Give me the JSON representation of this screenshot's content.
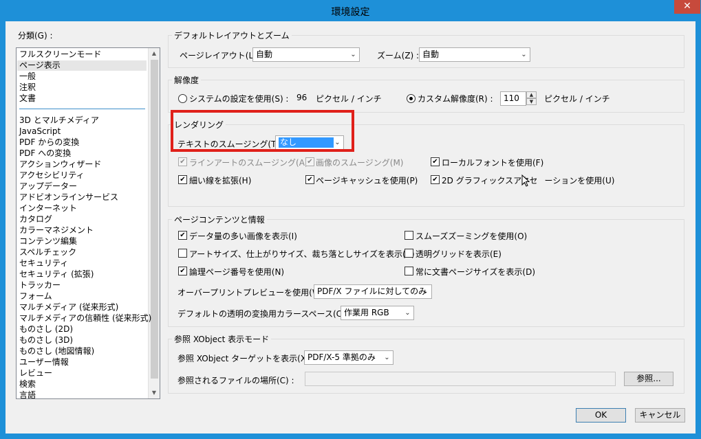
{
  "window": {
    "title": "環境設定",
    "close": "✕"
  },
  "category": {
    "label": "分類(G) :",
    "items": [
      "フルスクリーンモード",
      "ページ表示",
      "一般",
      "注釈",
      "文書",
      "3D とマルチメディア",
      "JavaScript",
      "PDF からの変換",
      "PDF への変換",
      "アクションウィザード",
      "アクセシビリティ",
      "アップデーター",
      "アドビオンラインサービス",
      "インターネット",
      "カタログ",
      "カラーマネジメント",
      "コンテンツ編集",
      "スペルチェック",
      "セキュリティ",
      "セキュリティ (拡張)",
      "トラッカー",
      "フォーム",
      "マルチメディア (従来形式)",
      "マルチメディアの信頼性 (従来形式)",
      "ものさし (2D)",
      "ものさし (3D)",
      "ものさし (地図情報)",
      "ユーザー情報",
      "レビュー",
      "検索",
      "言語"
    ],
    "selected": "ページ表示"
  },
  "layout": {
    "group_label": "デフォルトレイアウトとズーム",
    "page_layout_label": "ページレイアウト(L) :",
    "page_layout_value": "自動",
    "zoom_label": "ズーム(Z) :",
    "zoom_value": "自動"
  },
  "resolution": {
    "group_label": "解像度",
    "system_label": "システムの設定を使用(S) :",
    "system_value": "96",
    "system_unit": "ピクセル / インチ",
    "custom_label": "カスタム解像度(R) :",
    "custom_value": "110",
    "custom_unit": "ピクセル / インチ"
  },
  "rendering": {
    "group_label": "レンダリング",
    "text_smoothing_label": "テキストのスムージング(T) :",
    "text_smoothing_value": "なし",
    "line_art": "ラインアートのスムージング(A)",
    "image_smoothing": "画像のスムージング(M)",
    "local_fonts": "ローカルフォントを使用(F)",
    "thin_lines": "細い線を拡張(H)",
    "page_cache": "ページキャッシュを使用(P)",
    "gpu": "2D グラフィックスアクセラレーションを使用(U)",
    "gpu_visible": "2D グラフィックスアクセ",
    "gpu_tail": "ーションを使用(U)"
  },
  "content": {
    "group_label": "ページコンテンツと情報",
    "large_images": "データ量の多い画像を表示(I)",
    "art_sizes": "アートサイズ、仕上がりサイズ、裁ち落としサイズを表示(B)",
    "logical_pages": "論理ページ番号を使用(N)",
    "smooth_zoom": "スムーズズーミングを使用(O)",
    "transparency_grid": "透明グリッドを表示(E)",
    "doc_page_size": "常に文書ページサイズを表示(D)",
    "overprint_label": "オーバープリントプレビューを使用(W) :",
    "overprint_value": "PDF/X ファイルに対してのみ",
    "blend_label": "デフォルトの透明の変換用カラースペース(C) :",
    "blend_value": "作業用 RGB"
  },
  "xobject": {
    "group_label": "参照 XObject 表示モード",
    "target_label": "参照 XObject ターゲットを表示(X) :",
    "target_value": "PDF/X-5 準拠のみ",
    "location_label": "参照されるファイルの場所(C) :",
    "location_value": "",
    "browse": "参照..."
  },
  "footer": {
    "ok": "OK",
    "cancel": "キャンセル"
  },
  "icons": {
    "check": "✔",
    "arrow_down": "⌄",
    "scroll_up": "▲",
    "scroll_down": "▼",
    "close": "close-icon"
  },
  "colors": {
    "titlebar": "#1e90d8",
    "highlight_box": "#e0201a",
    "selection": "#3399ff",
    "close": "#c74a3c"
  }
}
